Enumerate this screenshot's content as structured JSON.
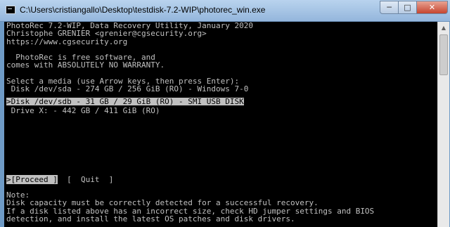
{
  "window": {
    "title": "C:\\Users\\cristiangallo\\Desktop\\testdisk-7.2-WIP\\photorec_win.exe",
    "minimize_glyph": "─",
    "maximize_glyph": "□",
    "close_glyph": "✕",
    "icons": [
      "console-app-icon",
      "minimize-icon",
      "maximize-icon",
      "close-icon"
    ]
  },
  "terminal": {
    "header": [
      "PhotoRec 7.2-WIP, Data Recovery Utility, January 2020",
      "Christophe GRENIER <grenier@cgsecurity.org>",
      "https://www.cgsecurity.org",
      "",
      "  PhotoRec is free software, and",
      "comes with ABSOLUTELY NO WARRANTY.",
      "",
      "Select a media (use Arrow keys, then press Enter):"
    ],
    "media": [
      " Disk /dev/sda - 274 GB / 256 GiB (RO) - Windows 7-0",
      ">Disk /dev/sdb - 31 GB / 29 GiB (RO) - SMI USB DISK",
      " Drive X: - 442 GB / 411 GiB (RO)"
    ],
    "selected_media_index": 1,
    "menu": {
      "proceed": ">[Proceed ]",
      "separator": "  [  ",
      "quit": "Quit",
      "quit_suffix": "  ]"
    },
    "note": [
      "Note:",
      "Disk capacity must be correctly detected for a successful recovery.",
      "If a disk listed above has an incorrect size, check HD jumper settings and BIOS",
      "detection, and install the latest OS patches and disk drivers."
    ]
  },
  "scrollbar": {
    "up_glyph": "▲"
  },
  "colors": {
    "background": "#000000",
    "text": "#c0c0c0",
    "highlight": "#c0c0c0",
    "titlebar": "#b9d3ee",
    "close": "#c6452f"
  }
}
